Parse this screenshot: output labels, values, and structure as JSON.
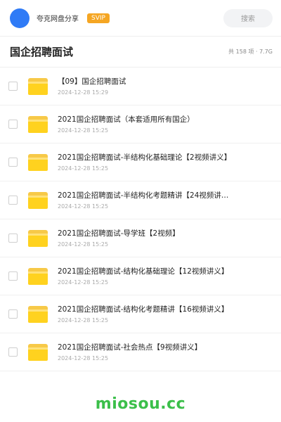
{
  "header": {
    "username": "夸克网盘分享",
    "badge": "SVIP",
    "search_label": "搜索"
  },
  "folder": {
    "title": "国企招聘面试",
    "meta": "共 158 项 · 7.7G"
  },
  "items": [
    {
      "name": "【09】国企招聘面试",
      "date": "2024-12-28 15:29"
    },
    {
      "name": "2021国企招聘面试（本套适用所有国企）",
      "date": "2024-12-28 15:25"
    },
    {
      "name": "2021国企招聘面试-半结构化基础理论【2视频讲义】",
      "date": "2024-12-28 15:25"
    },
    {
      "name": "2021国企招聘面试-半结构化考题精讲【24视频讲…",
      "date": "2024-12-28 15:25"
    },
    {
      "name": "2021国企招聘面试-导学班【2视频】",
      "date": "2024-12-28 15:25"
    },
    {
      "name": "2021国企招聘面试-结构化基础理论【12视频讲义】",
      "date": "2024-12-28 15:25"
    },
    {
      "name": "2021国企招聘面试-结构化考题精讲【16视频讲义】",
      "date": "2024-12-28 15:25"
    },
    {
      "name": "2021国企招聘面试-社会热点【9视频讲义】",
      "date": "2024-12-28 15:25"
    }
  ],
  "watermark": "miosou.cc",
  "colors": {
    "avatar": "#2f7bf6",
    "badge": "#f5a623",
    "folder": "#ffd21f",
    "watermark": "#3bbf4a"
  }
}
